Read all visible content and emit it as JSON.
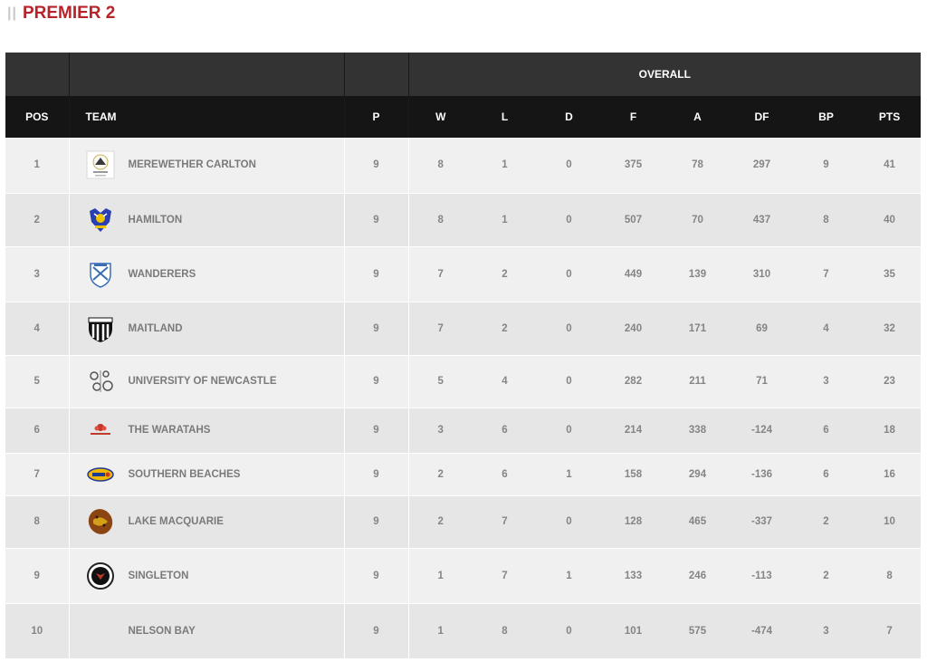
{
  "heading": {
    "bars": "||",
    "title": "PREMIER 2"
  },
  "table": {
    "group_header": "OVERALL",
    "columns": {
      "pos": "POS",
      "team": "TEAM",
      "p": "P",
      "w": "W",
      "l": "L",
      "d": "D",
      "f": "F",
      "a": "A",
      "df": "DF",
      "bp": "BP",
      "pts": "PTS"
    },
    "rows": [
      {
        "pos": "1",
        "team": "MEREWETHER CARLTON",
        "logo": "merewether-carlton-logo",
        "p": "9",
        "w": "8",
        "l": "1",
        "d": "0",
        "f": "375",
        "a": "78",
        "df": "297",
        "bp": "9",
        "pts": "41"
      },
      {
        "pos": "2",
        "team": "HAMILTON",
        "logo": "hamilton-logo",
        "p": "9",
        "w": "8",
        "l": "1",
        "d": "0",
        "f": "507",
        "a": "70",
        "df": "437",
        "bp": "8",
        "pts": "40"
      },
      {
        "pos": "3",
        "team": "WANDERERS",
        "logo": "wanderers-logo",
        "p": "9",
        "w": "7",
        "l": "2",
        "d": "0",
        "f": "449",
        "a": "139",
        "df": "310",
        "bp": "7",
        "pts": "35"
      },
      {
        "pos": "4",
        "team": "MAITLAND",
        "logo": "maitland-logo",
        "p": "9",
        "w": "7",
        "l": "2",
        "d": "0",
        "f": "240",
        "a": "171",
        "df": "69",
        "bp": "4",
        "pts": "32"
      },
      {
        "pos": "5",
        "team": "UNIVERSITY OF NEWCASTLE",
        "logo": "university-of-newcastle-logo",
        "p": "9",
        "w": "5",
        "l": "4",
        "d": "0",
        "f": "282",
        "a": "211",
        "df": "71",
        "bp": "3",
        "pts": "23"
      },
      {
        "pos": "6",
        "team": "THE WARATAHS",
        "logo": "the-waratahs-logo",
        "p": "9",
        "w": "3",
        "l": "6",
        "d": "0",
        "f": "214",
        "a": "338",
        "df": "-124",
        "bp": "6",
        "pts": "18"
      },
      {
        "pos": "7",
        "team": "SOUTHERN BEACHES",
        "logo": "southern-beaches-logo",
        "p": "9",
        "w": "2",
        "l": "6",
        "d": "1",
        "f": "158",
        "a": "294",
        "df": "-136",
        "bp": "6",
        "pts": "16"
      },
      {
        "pos": "8",
        "team": "LAKE MACQUARIE",
        "logo": "lake-macquarie-logo",
        "p": "9",
        "w": "2",
        "l": "7",
        "d": "0",
        "f": "128",
        "a": "465",
        "df": "-337",
        "bp": "2",
        "pts": "10"
      },
      {
        "pos": "9",
        "team": "SINGLETON",
        "logo": "singleton-logo",
        "p": "9",
        "w": "1",
        "l": "7",
        "d": "1",
        "f": "133",
        "a": "246",
        "df": "-113",
        "bp": "2",
        "pts": "8"
      },
      {
        "pos": "10",
        "team": "NELSON BAY",
        "logo": "",
        "p": "9",
        "w": "1",
        "l": "8",
        "d": "0",
        "f": "101",
        "a": "575",
        "df": "-474",
        "bp": "3",
        "pts": "7"
      }
    ]
  },
  "colors": {
    "title": "#b8232a",
    "header_dark": "#151515",
    "header_top": "#333333",
    "row_light": "#f0f0f0",
    "row_dark": "#e6e6e6",
    "text": "#858585"
  }
}
